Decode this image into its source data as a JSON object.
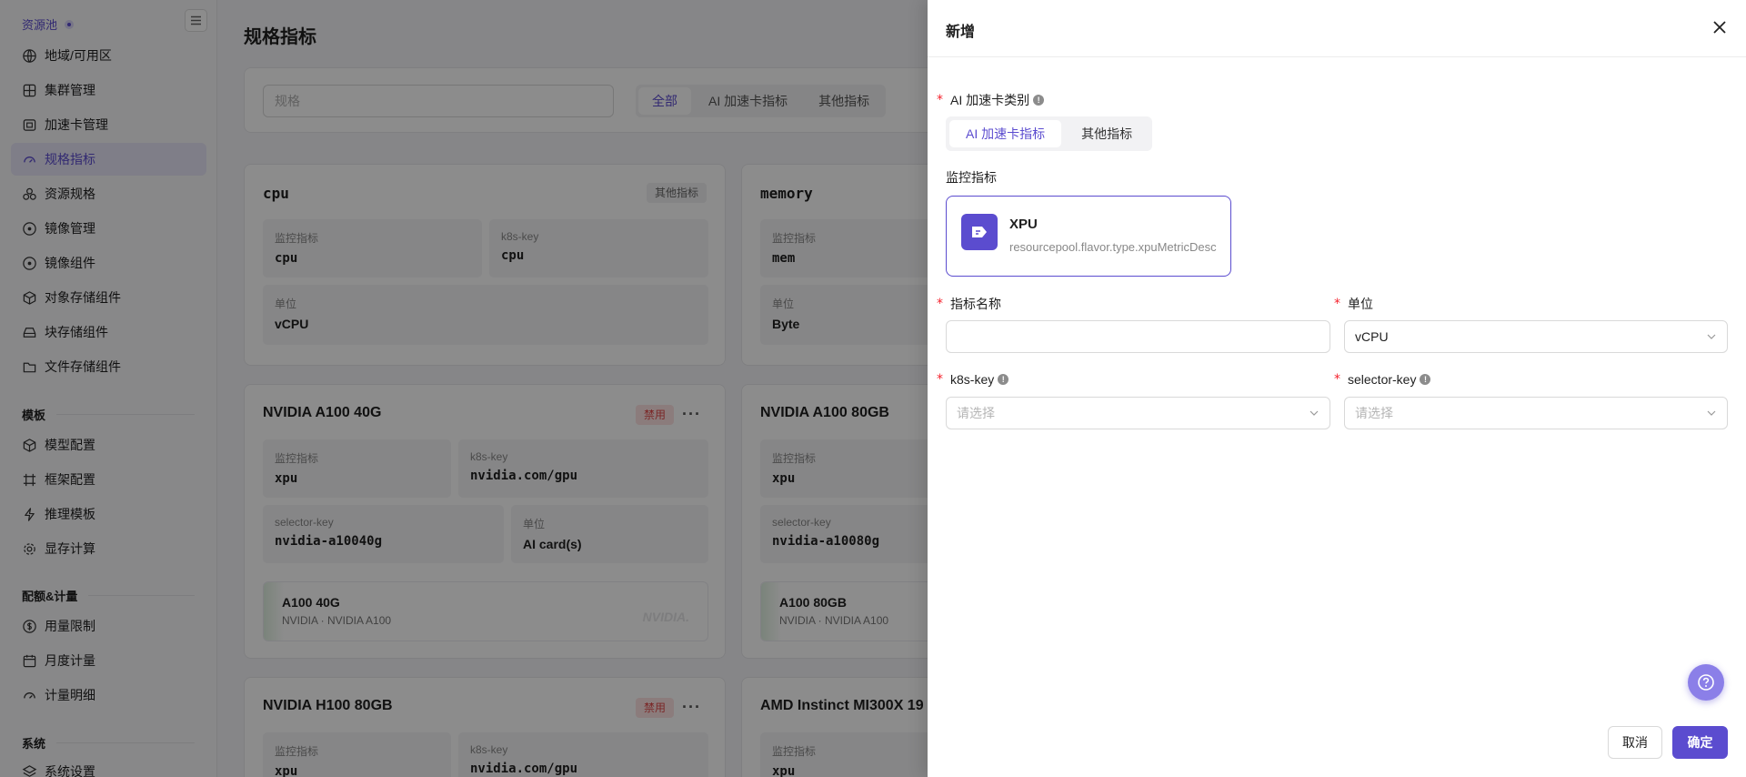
{
  "sidebar": {
    "pool_label": "资源池",
    "items": [
      {
        "label": "地域/可用区",
        "icon": "globe-icon"
      },
      {
        "label": "集群管理",
        "icon": "cluster-icon"
      },
      {
        "label": "加速卡管理",
        "icon": "card-icon"
      },
      {
        "label": "规格指标",
        "icon": "gauge-icon",
        "active": true
      },
      {
        "label": "资源规格",
        "icon": "cubes-icon"
      },
      {
        "label": "镜像管理",
        "icon": "disc-icon"
      },
      {
        "label": "镜像组件",
        "icon": "disc-icon"
      },
      {
        "label": "对象存储组件",
        "icon": "box-icon"
      },
      {
        "label": "块存储组件",
        "icon": "drive-icon"
      },
      {
        "label": "文件存储组件",
        "icon": "folder-icon"
      }
    ],
    "group_template": "模板",
    "template_items": [
      {
        "label": "模型配置",
        "icon": "box-icon"
      },
      {
        "label": "框架配置",
        "icon": "frame-icon"
      },
      {
        "label": "推理模板",
        "icon": "bolt-icon"
      },
      {
        "label": "显存计算",
        "icon": "gear-icon"
      }
    ],
    "group_quota": "配额&计量",
    "quota_items": [
      {
        "label": "用量限制",
        "icon": "dollar-icon"
      },
      {
        "label": "月度计量",
        "icon": "calendar-icon"
      },
      {
        "label": "计量明细",
        "icon": "gauge-icon"
      }
    ],
    "group_system": "系统",
    "system_items": [
      {
        "label": "系统设置",
        "icon": "layers-icon"
      }
    ]
  },
  "main": {
    "title": "规格指标",
    "search_placeholder": "规格",
    "filter_tabs": [
      "全部",
      "AI 加速卡指标",
      "其他指标"
    ],
    "cards": {
      "cpu": {
        "title": "cpu",
        "tag": "其他指标",
        "metric_k": "监控指标",
        "metric_v": "cpu",
        "k8s_k": "k8s-key",
        "k8s_v": "cpu",
        "unit_k": "单位",
        "unit_v": "vCPU"
      },
      "memory": {
        "title": "memory",
        "metric_k": "监控指标",
        "metric_v": "mem",
        "unit_k": "单位",
        "unit_v": "Byte"
      },
      "a100_40": {
        "title": "NVIDIA A100 40G",
        "tag": "禁用",
        "more": "···",
        "metric_k": "监控指标",
        "metric_v": "xpu",
        "k8s_k": "k8s-key",
        "k8s_v": "nvidia.com/gpu",
        "sel_k": "selector-key",
        "sel_v": "nvidia-a10040g",
        "unit_k": "单位",
        "unit_v": "AI card(s)",
        "gpu_name": "A100 40G",
        "gpu_sub": "NVIDIA · NVIDIA A100",
        "logo": "NVIDIA."
      },
      "a100_80": {
        "title": "NVIDIA A100 80GB",
        "metric_k": "监控指标",
        "metric_v": "xpu",
        "sel_k": "selector-key",
        "sel_v": "nvidia-a10080g",
        "gpu_name": "A100 80GB",
        "gpu_sub": "NVIDIA · NVIDIA A100"
      },
      "h100_80": {
        "title": "NVIDIA H100 80GB",
        "tag": "禁用",
        "more": "···",
        "metric_k": "监控指标",
        "metric_v": "xpu",
        "k8s_k": "k8s-key",
        "k8s_v": "nvidia.com/gpu"
      },
      "mi300": {
        "title": "AMD Instinct MI300X 19",
        "metric_k": "监控指标",
        "metric_v": "xpu"
      }
    }
  },
  "drawer": {
    "title": "新增",
    "accel_type_label": "AI 加速卡类别",
    "accel_tabs": [
      "AI 加速卡指标",
      "其他指标"
    ],
    "monitor_label": "监控指标",
    "metric_name": "XPU",
    "metric_desc": "resourcepool.flavor.type.xpuMetricDesc",
    "name_label": "指标名称",
    "name_value": "",
    "unit_label": "单位",
    "unit_value": "vCPU",
    "k8s_label": "k8s-key",
    "k8s_placeholder": "请选择",
    "selector_label": "selector-key",
    "selector_placeholder": "请选择",
    "cancel": "取消",
    "confirm": "确定"
  },
  "colors": {
    "accent": "#5b4ccf",
    "danger": "#e04848"
  }
}
